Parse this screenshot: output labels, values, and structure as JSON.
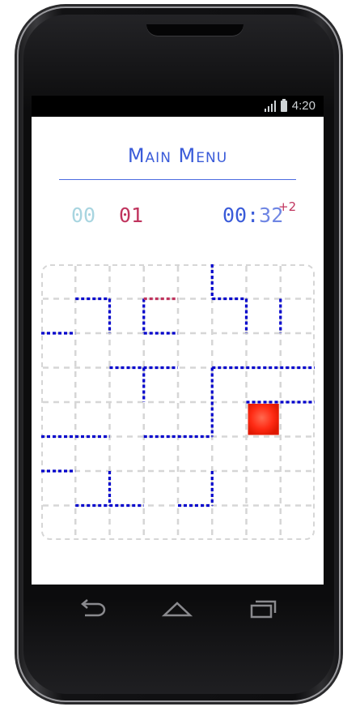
{
  "status_bar": {
    "time": "4:20",
    "signal_icon": "signal-icon",
    "battery_icon": "battery-icon"
  },
  "menu": {
    "title": "Main Menu"
  },
  "scoreboard": {
    "player1_score": "00",
    "player2_score": "01",
    "timer_prefix": "00:",
    "timer_seconds": "32",
    "bonus": "+2"
  },
  "colors": {
    "accent_blue": "#0000cc",
    "player_red": "#c0345e",
    "cursor_red": "#ff2b14",
    "grid_gray": "#d6d6d6"
  },
  "board": {
    "columns": 8,
    "rows": 8,
    "walls_blue": [
      [
        0,
        2,
        1,
        2
      ],
      [
        1,
        1,
        2,
        1
      ],
      [
        2,
        1,
        2,
        2
      ],
      [
        2,
        3,
        4,
        3
      ],
      [
        3,
        3,
        3,
        4
      ],
      [
        3,
        1,
        3,
        2
      ],
      [
        3,
        2,
        4,
        2
      ],
      [
        5,
        0,
        5,
        1
      ],
      [
        5,
        1,
        6,
        1
      ],
      [
        6,
        1,
        6,
        2
      ],
      [
        7,
        1,
        7,
        2
      ],
      [
        5,
        3,
        8,
        3
      ],
      [
        5,
        3,
        5,
        5
      ],
      [
        3,
        5,
        5,
        5
      ],
      [
        0,
        5,
        2,
        5
      ],
      [
        6,
        4,
        8,
        4
      ],
      [
        0,
        6,
        1,
        6
      ],
      [
        2,
        6,
        2,
        7
      ],
      [
        1,
        7,
        3,
        7
      ],
      [
        5,
        6,
        5,
        7
      ],
      [
        4,
        7,
        5,
        7
      ]
    ],
    "walls_red": [
      [
        3,
        1,
        4,
        1
      ]
    ],
    "cursor_cell": [
      6,
      4
    ]
  },
  "navigation": {
    "back_icon": "back-icon",
    "home_icon": "home-icon",
    "recents_icon": "recents-icon"
  }
}
